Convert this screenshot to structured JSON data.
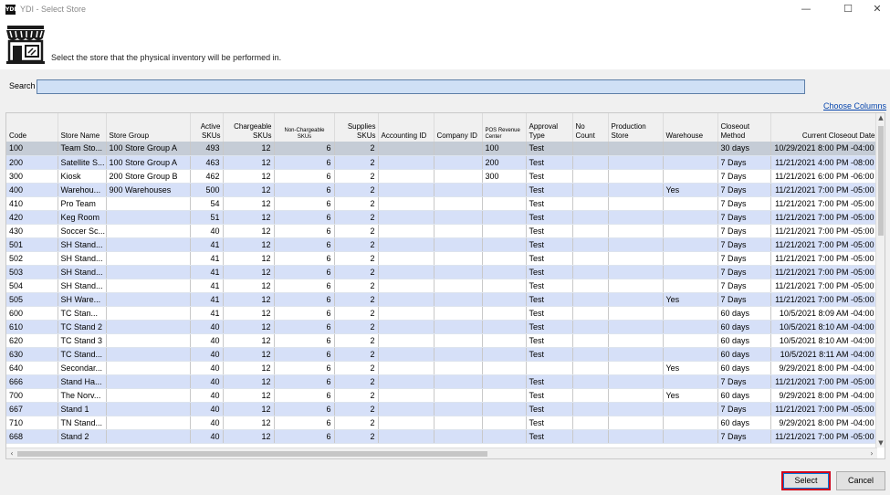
{
  "window": {
    "app_badge": "YDI",
    "title": "YDI - Select Store",
    "minimize_glyph": "—",
    "maximize_glyph": "☐",
    "close_glyph": "✕"
  },
  "header": {
    "icon": "store-icon",
    "instruction": "Select the store that the physical inventory will be performed in."
  },
  "search": {
    "label": "Search",
    "value": ""
  },
  "choose_columns": "Choose Columns",
  "columns": [
    "Code",
    "Store Name",
    "Store Group",
    "Active SKUs",
    "Chargeable SKUs",
    "Non-Chargeable SKUs",
    "Supplies SKUs",
    "Accounting ID",
    "Company ID",
    "POS Revenue Center",
    "Approval Type",
    "No Count",
    "Production Store",
    "Warehouse",
    "Closeout Method",
    "Current Closeout Date"
  ],
  "rows": [
    [
      "100",
      "Team Sto...",
      "100 Store Group A",
      "493",
      "12",
      "6",
      "2",
      "",
      "",
      "100",
      "Test",
      "",
      "",
      "",
      "30 days",
      "10/29/2021 8:00 PM -04:00"
    ],
    [
      "200",
      "Satellite S...",
      "100 Store Group A",
      "463",
      "12",
      "6",
      "2",
      "",
      "",
      "200",
      "Test",
      "",
      "",
      "",
      "7 Days",
      "11/21/2021 4:00 PM -08:00"
    ],
    [
      "300",
      "Kiosk",
      "200 Store Group B",
      "462",
      "12",
      "6",
      "2",
      "",
      "",
      "300",
      "Test",
      "",
      "",
      "",
      "7 Days",
      "11/21/2021 6:00 PM -06:00"
    ],
    [
      "400",
      "Warehou...",
      "900 Warehouses",
      "500",
      "12",
      "6",
      "2",
      "",
      "",
      "",
      "Test",
      "",
      "",
      "Yes",
      "7 Days",
      "11/21/2021 7:00 PM -05:00"
    ],
    [
      "410",
      "Pro Team",
      "",
      "54",
      "12",
      "6",
      "2",
      "",
      "",
      "",
      "Test",
      "",
      "",
      "",
      "7 Days",
      "11/21/2021 7:00 PM -05:00"
    ],
    [
      "420",
      "Keg Room",
      "",
      "51",
      "12",
      "6",
      "2",
      "",
      "",
      "",
      "Test",
      "",
      "",
      "",
      "7 Days",
      "11/21/2021 7:00 PM -05:00"
    ],
    [
      "430",
      "Soccer Sc...",
      "",
      "40",
      "12",
      "6",
      "2",
      "",
      "",
      "",
      "Test",
      "",
      "",
      "",
      "7 Days",
      "11/21/2021 7:00 PM -05:00"
    ],
    [
      "501",
      "SH Stand...",
      "",
      "41",
      "12",
      "6",
      "2",
      "",
      "",
      "",
      "Test",
      "",
      "",
      "",
      "7 Days",
      "11/21/2021 7:00 PM -05:00"
    ],
    [
      "502",
      "SH Stand...",
      "",
      "41",
      "12",
      "6",
      "2",
      "",
      "",
      "",
      "Test",
      "",
      "",
      "",
      "7 Days",
      "11/21/2021 7:00 PM -05:00"
    ],
    [
      "503",
      "SH Stand...",
      "",
      "41",
      "12",
      "6",
      "2",
      "",
      "",
      "",
      "Test",
      "",
      "",
      "",
      "7 Days",
      "11/21/2021 7:00 PM -05:00"
    ],
    [
      "504",
      "SH Stand...",
      "",
      "41",
      "12",
      "6",
      "2",
      "",
      "",
      "",
      "Test",
      "",
      "",
      "",
      "7 Days",
      "11/21/2021 7:00 PM -05:00"
    ],
    [
      "505",
      "SH Ware...",
      "",
      "41",
      "12",
      "6",
      "2",
      "",
      "",
      "",
      "Test",
      "",
      "",
      "Yes",
      "7 Days",
      "11/21/2021 7:00 PM -05:00"
    ],
    [
      "600",
      "TC   Stan...",
      "",
      "41",
      "12",
      "6",
      "2",
      "",
      "",
      "",
      "Test",
      "",
      "",
      "",
      "60 days",
      "10/5/2021 8:09 AM -04:00"
    ],
    [
      "610",
      "TC Stand 2",
      "",
      "40",
      "12",
      "6",
      "2",
      "",
      "",
      "",
      "Test",
      "",
      "",
      "",
      "60 days",
      "10/5/2021 8:10 AM -04:00"
    ],
    [
      "620",
      "TC Stand 3",
      "",
      "40",
      "12",
      "6",
      "2",
      "",
      "",
      "",
      "Test",
      "",
      "",
      "",
      "60 days",
      "10/5/2021 8:10 AM -04:00"
    ],
    [
      "630",
      "TC Stand...",
      "",
      "40",
      "12",
      "6",
      "2",
      "",
      "",
      "",
      "Test",
      "",
      "",
      "",
      "60 days",
      "10/5/2021 8:11 AM -04:00"
    ],
    [
      "640",
      "Secondar...",
      "",
      "40",
      "12",
      "6",
      "2",
      "",
      "",
      "",
      "",
      "",
      "",
      "Yes",
      "60 days",
      "9/29/2021 8:00 PM -04:00"
    ],
    [
      "666",
      "Stand Ha...",
      "",
      "40",
      "12",
      "6",
      "2",
      "",
      "",
      "",
      "Test",
      "",
      "",
      "",
      "7 Days",
      "11/21/2021 7:00 PM -05:00"
    ],
    [
      "700",
      "The Norv...",
      "",
      "40",
      "12",
      "6",
      "2",
      "",
      "",
      "",
      "Test",
      "",
      "",
      "Yes",
      "60 days",
      "9/29/2021 8:00 PM -04:00"
    ],
    [
      "667",
      "Stand 1",
      "",
      "40",
      "12",
      "6",
      "2",
      "",
      "",
      "",
      "Test",
      "",
      "",
      "",
      "7 Days",
      "11/21/2021 7:00 PM -05:00"
    ],
    [
      "710",
      "TN Stand...",
      "",
      "40",
      "12",
      "6",
      "2",
      "",
      "",
      "",
      "Test",
      "",
      "",
      "",
      "60 days",
      "9/29/2021 8:00 PM -04:00"
    ],
    [
      "668",
      "Stand 2",
      "",
      "40",
      "12",
      "6",
      "2",
      "",
      "",
      "",
      "Test",
      "",
      "",
      "",
      "7 Days",
      "11/21/2021 7:00 PM -05:00"
    ]
  ],
  "buttons": {
    "select": "Select",
    "cancel": "Cancel"
  },
  "colors": {
    "selected_button_outline": "#d0021b",
    "row_alt": "#d6e0f8",
    "search_bg": "#cfe0f5",
    "link": "#0645ad"
  }
}
